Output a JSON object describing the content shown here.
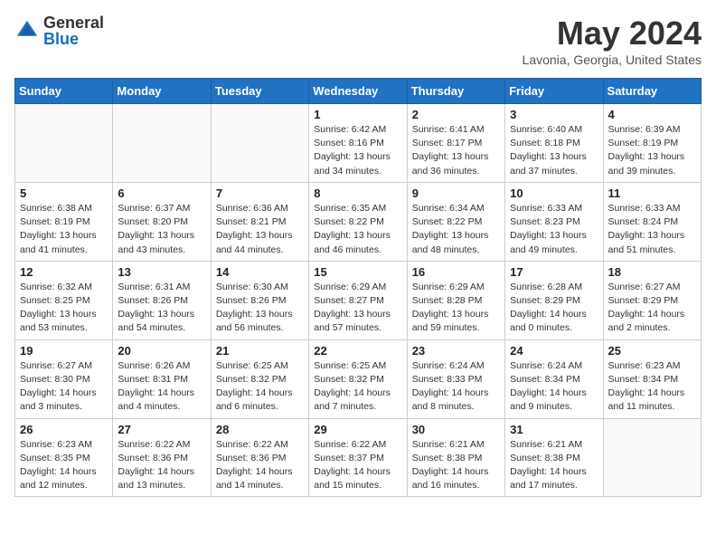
{
  "header": {
    "logo_general": "General",
    "logo_blue": "Blue",
    "month_title": "May 2024",
    "location": "Lavonia, Georgia, United States"
  },
  "days_of_week": [
    "Sunday",
    "Monday",
    "Tuesday",
    "Wednesday",
    "Thursday",
    "Friday",
    "Saturday"
  ],
  "weeks": [
    [
      {
        "day": "",
        "info": ""
      },
      {
        "day": "",
        "info": ""
      },
      {
        "day": "",
        "info": ""
      },
      {
        "day": "1",
        "info": "Sunrise: 6:42 AM\nSunset: 8:16 PM\nDaylight: 13 hours and 34 minutes."
      },
      {
        "day": "2",
        "info": "Sunrise: 6:41 AM\nSunset: 8:17 PM\nDaylight: 13 hours and 36 minutes."
      },
      {
        "day": "3",
        "info": "Sunrise: 6:40 AM\nSunset: 8:18 PM\nDaylight: 13 hours and 37 minutes."
      },
      {
        "day": "4",
        "info": "Sunrise: 6:39 AM\nSunset: 8:19 PM\nDaylight: 13 hours and 39 minutes."
      }
    ],
    [
      {
        "day": "5",
        "info": "Sunrise: 6:38 AM\nSunset: 8:19 PM\nDaylight: 13 hours and 41 minutes."
      },
      {
        "day": "6",
        "info": "Sunrise: 6:37 AM\nSunset: 8:20 PM\nDaylight: 13 hours and 43 minutes."
      },
      {
        "day": "7",
        "info": "Sunrise: 6:36 AM\nSunset: 8:21 PM\nDaylight: 13 hours and 44 minutes."
      },
      {
        "day": "8",
        "info": "Sunrise: 6:35 AM\nSunset: 8:22 PM\nDaylight: 13 hours and 46 minutes."
      },
      {
        "day": "9",
        "info": "Sunrise: 6:34 AM\nSunset: 8:22 PM\nDaylight: 13 hours and 48 minutes."
      },
      {
        "day": "10",
        "info": "Sunrise: 6:33 AM\nSunset: 8:23 PM\nDaylight: 13 hours and 49 minutes."
      },
      {
        "day": "11",
        "info": "Sunrise: 6:33 AM\nSunset: 8:24 PM\nDaylight: 13 hours and 51 minutes."
      }
    ],
    [
      {
        "day": "12",
        "info": "Sunrise: 6:32 AM\nSunset: 8:25 PM\nDaylight: 13 hours and 53 minutes."
      },
      {
        "day": "13",
        "info": "Sunrise: 6:31 AM\nSunset: 8:26 PM\nDaylight: 13 hours and 54 minutes."
      },
      {
        "day": "14",
        "info": "Sunrise: 6:30 AM\nSunset: 8:26 PM\nDaylight: 13 hours and 56 minutes."
      },
      {
        "day": "15",
        "info": "Sunrise: 6:29 AM\nSunset: 8:27 PM\nDaylight: 13 hours and 57 minutes."
      },
      {
        "day": "16",
        "info": "Sunrise: 6:29 AM\nSunset: 8:28 PM\nDaylight: 13 hours and 59 minutes."
      },
      {
        "day": "17",
        "info": "Sunrise: 6:28 AM\nSunset: 8:29 PM\nDaylight: 14 hours and 0 minutes."
      },
      {
        "day": "18",
        "info": "Sunrise: 6:27 AM\nSunset: 8:29 PM\nDaylight: 14 hours and 2 minutes."
      }
    ],
    [
      {
        "day": "19",
        "info": "Sunrise: 6:27 AM\nSunset: 8:30 PM\nDaylight: 14 hours and 3 minutes."
      },
      {
        "day": "20",
        "info": "Sunrise: 6:26 AM\nSunset: 8:31 PM\nDaylight: 14 hours and 4 minutes."
      },
      {
        "day": "21",
        "info": "Sunrise: 6:25 AM\nSunset: 8:32 PM\nDaylight: 14 hours and 6 minutes."
      },
      {
        "day": "22",
        "info": "Sunrise: 6:25 AM\nSunset: 8:32 PM\nDaylight: 14 hours and 7 minutes."
      },
      {
        "day": "23",
        "info": "Sunrise: 6:24 AM\nSunset: 8:33 PM\nDaylight: 14 hours and 8 minutes."
      },
      {
        "day": "24",
        "info": "Sunrise: 6:24 AM\nSunset: 8:34 PM\nDaylight: 14 hours and 9 minutes."
      },
      {
        "day": "25",
        "info": "Sunrise: 6:23 AM\nSunset: 8:34 PM\nDaylight: 14 hours and 11 minutes."
      }
    ],
    [
      {
        "day": "26",
        "info": "Sunrise: 6:23 AM\nSunset: 8:35 PM\nDaylight: 14 hours and 12 minutes."
      },
      {
        "day": "27",
        "info": "Sunrise: 6:22 AM\nSunset: 8:36 PM\nDaylight: 14 hours and 13 minutes."
      },
      {
        "day": "28",
        "info": "Sunrise: 6:22 AM\nSunset: 8:36 PM\nDaylight: 14 hours and 14 minutes."
      },
      {
        "day": "29",
        "info": "Sunrise: 6:22 AM\nSunset: 8:37 PM\nDaylight: 14 hours and 15 minutes."
      },
      {
        "day": "30",
        "info": "Sunrise: 6:21 AM\nSunset: 8:38 PM\nDaylight: 14 hours and 16 minutes."
      },
      {
        "day": "31",
        "info": "Sunrise: 6:21 AM\nSunset: 8:38 PM\nDaylight: 14 hours and 17 minutes."
      },
      {
        "day": "",
        "info": ""
      }
    ]
  ]
}
